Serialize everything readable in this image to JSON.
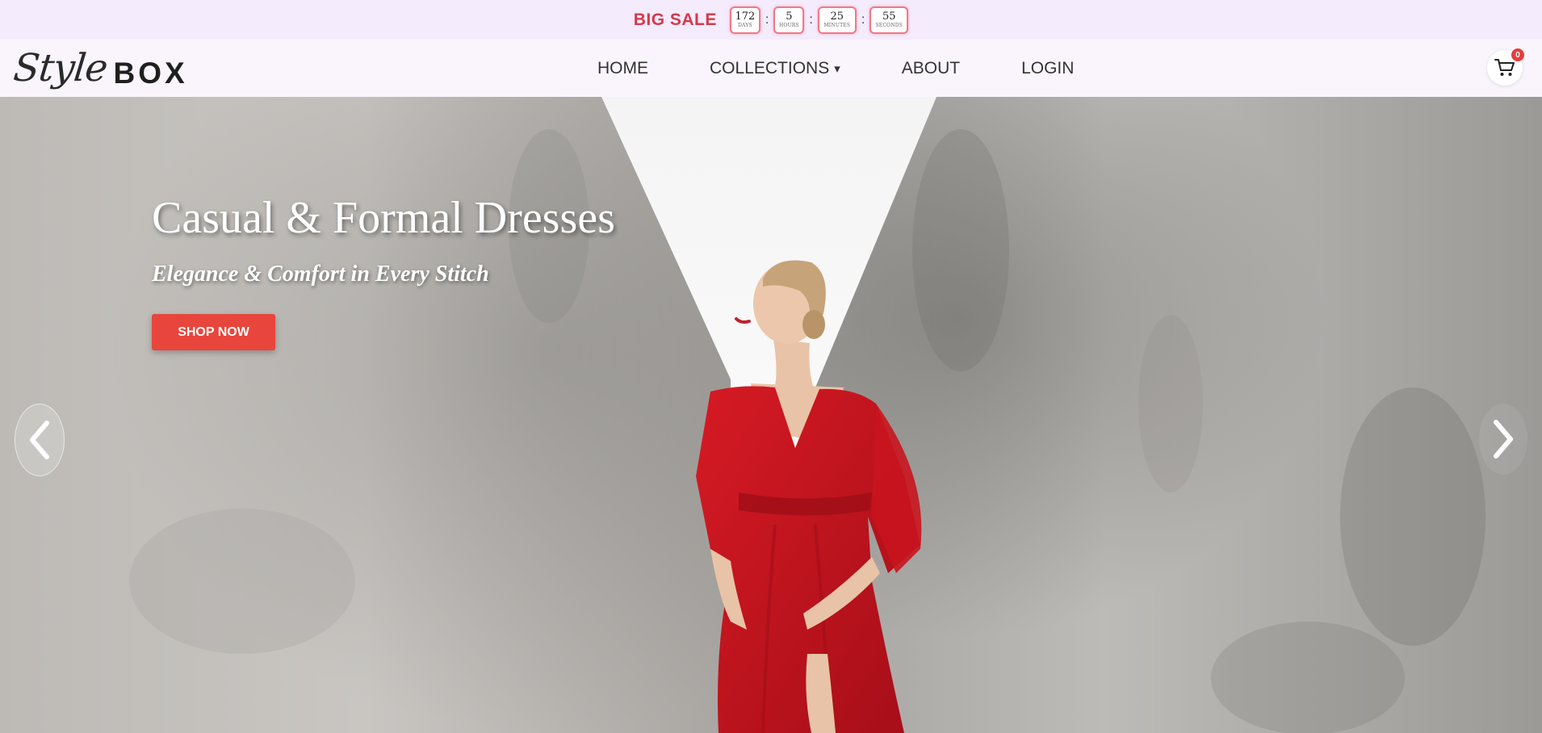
{
  "promo": {
    "label": "BIG SALE",
    "countdown": [
      {
        "value": "172",
        "unit": "DAYS"
      },
      {
        "value": "5",
        "unit": "HOURS"
      },
      {
        "value": "25",
        "unit": "MINUTES"
      },
      {
        "value": "55",
        "unit": "SECONDS"
      }
    ],
    "separator": ":"
  },
  "header": {
    "logo_script": "Style",
    "logo_box": "BOX",
    "nav": [
      {
        "label": "HOME"
      },
      {
        "label": "COLLECTIONS"
      },
      {
        "label": "ABOUT"
      },
      {
        "label": "LOGIN"
      }
    ],
    "collections_caret": "▾",
    "cart_count": "0",
    "cart_icon": "cart-icon"
  },
  "hero": {
    "title": "Casual & Formal Dresses",
    "subtitle": "Elegance & Comfort in Every Stitch",
    "cta_label": "SHOP NOW",
    "prev_icon": "chevron-left-icon",
    "next_icon": "chevron-right-icon"
  },
  "colors": {
    "sale_red": "#d4394a",
    "cta_red": "#e8453c",
    "dress_red": "#c8141f",
    "promo_bg": "#f4ebfd",
    "header_bg": "#faf5fd"
  }
}
